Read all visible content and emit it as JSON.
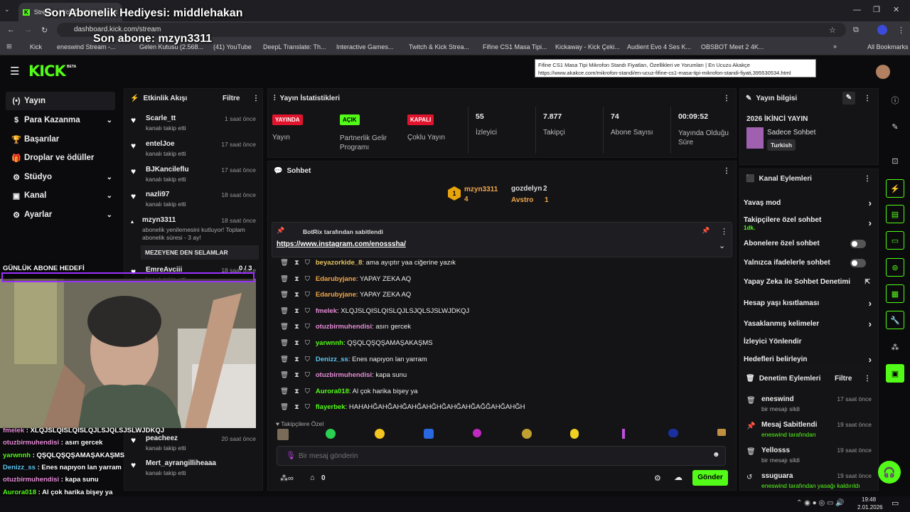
{
  "browser": {
    "tab_title": "Stream - Kick Dashboard",
    "url": "dashboard.kick.com/stream",
    "bookmarks": [
      "Kick",
      "eneswind Stream -...",
      "Gelen Kutusu (2.568...",
      "(41) YouTube",
      "DeepL Translate: Th...",
      "Interactive Games...",
      "Twitch & Kick Strea...",
      "Fifine CS1 Masa Tipi...",
      "Kickaway - Kick Çeki...",
      "Audient Evo 4 Ses K...",
      "OBSBOT Meet 2 4K...",
      "All Bookmarks"
    ],
    "tooltip_title": "Fifine CS1 Masa Tipi Mikrofon Standı Fiyatları, Özellikleri ve Yorumları | En Ucuzu Akakçe",
    "tooltip_url": "https://www.akakce.com/mikrofon-standi/en-ucuz-fifine-cs1-masa-tipi-mikrofon-standi-fiyati,395530534.html"
  },
  "overlay": {
    "last_gift": "Son Abonelik Hediyesi: middlehakan",
    "last_sub": "Son abone: mzyn3311",
    "goal_label": "GÜNLÜK ABONE HEDEFİ",
    "goal_value": "0 / 3",
    "goal_progress": 0
  },
  "kick": {
    "logo": "KICK",
    "beta": "BETA"
  },
  "sidebar": [
    {
      "label": "Yayın",
      "icon": "(•)"
    },
    {
      "label": "Para Kazanma",
      "icon": "$"
    },
    {
      "label": "Başarılar",
      "icon": "🏆"
    },
    {
      "label": "Droplar ve ödüller",
      "icon": "🎁"
    },
    {
      "label": "Stüdyo",
      "icon": "⚙"
    },
    {
      "label": "Kanal",
      "icon": "▣"
    },
    {
      "label": "Ayarlar",
      "icon": "⚙"
    }
  ],
  "events": {
    "title": "Etkinlik Akışı",
    "filter": "Filtre",
    "items": [
      {
        "name": "Scarle_tt",
        "sub": "kanalı takip etti",
        "time": "1 saat önce"
      },
      {
        "name": "entelJoe",
        "sub": "kanalı takip etti",
        "time": "17 saat önce"
      },
      {
        "name": "BJKancileflu",
        "sub": "kanalı takip etti",
        "time": "17 saat önce"
      },
      {
        "name": "nazli97",
        "sub": "kanalı takip etti",
        "time": "18 saat önce"
      },
      {
        "name": "mzyn3311",
        "sub": "abonelik yenilemesini kutluyor! Toplam abonelik süresi - 3 ay!",
        "time": "18 saat önce",
        "message": "MEZEYENE DEN SELAMLAR"
      },
      {
        "name": "EmreAvciii",
        "sub": "kanalı takip etti",
        "time": "18 saat önce"
      },
      {
        "name": "peacheez",
        "sub": "kanalı takip etti",
        "time": "20 saat önce"
      },
      {
        "name": "Mert_ayrangilliheaaa",
        "sub": "kanalı takip etti",
        "time": ""
      }
    ]
  },
  "stats": {
    "title": "Yayın İstatistikleri",
    "items": [
      {
        "badge": "YAYINDA",
        "label": "Yayın"
      },
      {
        "badge": "AÇIK",
        "label": "Partnerlik Gelir Programı"
      },
      {
        "badge": "KAPALI",
        "label": "Çoklu Yayın"
      },
      {
        "value": "55",
        "label": "İzleyici"
      },
      {
        "value": "7.877",
        "label": "Takipçi"
      },
      {
        "value": "74",
        "label": "Abone Sayısı"
      },
      {
        "value": "00:09:52",
        "label": "Yayında Olduğu Süre"
      }
    ]
  },
  "chat": {
    "title": "Sohbet",
    "top1": "mzyn3311",
    "top1_count": "4",
    "top2": "gozdelyn",
    "top2_count": "2",
    "top3": "Avstro",
    "top3_count": "1",
    "pinned_by": "BotRix tarafından sabitlendi",
    "pinned_link": "https://www.instagram.com/enosssha/",
    "messages": [
      {
        "user": "beyazorkide_8",
        "text": "ama ayıptır yaa ciğerine yazık",
        "color": "#e6c35c"
      },
      {
        "user": "Edarubyjane",
        "text": "YAPAY ZEKA AQ",
        "color": "#f0a64c"
      },
      {
        "user": "Edarubyjane",
        "text": "YAPAY ZEKA AQ",
        "color": "#f0a64c"
      },
      {
        "user": "fmelek",
        "text": "XLQJSLQISLQISLQJLSJQLSJSLWJDKQJ",
        "color": "#e58bd6"
      },
      {
        "user": "otuzbirmuhendisi",
        "text": "asırı gercek",
        "color": "#e58bd6"
      },
      {
        "user": "yarwnnh",
        "text": "QŞQLQŞQŞAMAŞAKAŞMS",
        "color": "#53fc18"
      },
      {
        "user": "Denizz_ss",
        "text": "Enes napıyon lan yarram",
        "color": "#5cc6f0"
      },
      {
        "user": "otuzbirmuhendisi",
        "text": "kapa sunu",
        "color": "#e58bd6"
      },
      {
        "user": "Aurora018",
        "text": "Al çok harika bişey ya",
        "color": "#53fc18"
      },
      {
        "user": "flayerbek",
        "text": "HAHAHĞAHĞAHĞAHĞAHĞHĞAHĞAHĞAĞĞAHĞAHĞH",
        "color": "#53fc18"
      }
    ],
    "emote_label": "Takipçilere Özel",
    "placeholder": "Bir mesaj gönderin",
    "points": "0",
    "send": "Gönder"
  },
  "stream_info": {
    "title": "Yayın bilgisi",
    "stream_title": "2026 İKİNCİ YAYIN",
    "category": "Sadece Sohbet",
    "language": "Turkish"
  },
  "channel_actions": {
    "title": "Kanal Eylemleri",
    "items": [
      {
        "label": "Yavaş mod",
        "kind": "chevron"
      },
      {
        "label": "Takipçilere özel sohbet",
        "sub": "1dk.",
        "kind": "chevron"
      },
      {
        "label": "Abonelere özel sohbet",
        "kind": "toggle"
      },
      {
        "label": "Yalnızca ifadelerle sohbet",
        "kind": "toggle"
      },
      {
        "label": "Yapay Zeka ile Sohbet Denetimi",
        "kind": "external"
      },
      {
        "label": "Hesap yaşı kısıtlaması",
        "kind": "chevron"
      },
      {
        "label": "Yasaklanmış kelimeler",
        "kind": "chevron"
      },
      {
        "label": "İzleyici Yönlendir",
        "kind": "none"
      },
      {
        "label": "Hedefleri belirleyin",
        "kind": "chevron"
      }
    ]
  },
  "mod_actions": {
    "title": "Denetim Eylemleri",
    "filter": "Filtre",
    "items": [
      {
        "name": "eneswind",
        "sub": "bir mesajı sildi",
        "time": "17 saat önce",
        "icon": "🗑"
      },
      {
        "name": "Mesaj Sabitlendi",
        "sub": "eneswind tarafından",
        "time": "19 saat önce",
        "icon": "📌"
      },
      {
        "name": "Yellosss",
        "sub": "bir mesajı sildi",
        "time": "19 saat önce",
        "icon": "🗑"
      },
      {
        "name": "ssuguara",
        "sub": "eneswind tarafından yasağı kaldırıldı",
        "time": "19 saat önce",
        "icon": "↺"
      }
    ]
  },
  "overlay_chat": [
    {
      "user": "fmelek",
      "text": "XLQJSLQISLQISLQJLSJQLSJSLWJDKQJ",
      "color": "#e58bd6"
    },
    {
      "user": "otuzbirmuhendisi",
      "text": "asırı gercek",
      "color": "#e58bd6"
    },
    {
      "user": "yarwnnh",
      "text": "QŞQLQŞQŞAMAŞAKAŞMS",
      "color": "#53fc18"
    },
    {
      "user": "Denizz_ss",
      "text": "Enes napıyon lan yarram",
      "color": "#5cc6f0"
    },
    {
      "user": "otuzbirmuhendisi",
      "text": "kapa sunu",
      "color": "#e58bd6"
    },
    {
      "user": "Aurora018",
      "text": "Al çok harika bişey ya",
      "color": "#53fc18"
    },
    {
      "user": "flayerbek",
      "text": "HAHAHĞAHĞAHĞAHĞAHĞHĞAHĞAHĞAĞĞAHĞAHĞH",
      "color": "#53fc18"
    }
  ],
  "taskbar": {
    "time": "19:48",
    "date": "2.01.2026"
  },
  "colors": {
    "kick_green": "#53fc18",
    "live_red": "#e0152d",
    "goal_purple": "#9b30ff"
  }
}
